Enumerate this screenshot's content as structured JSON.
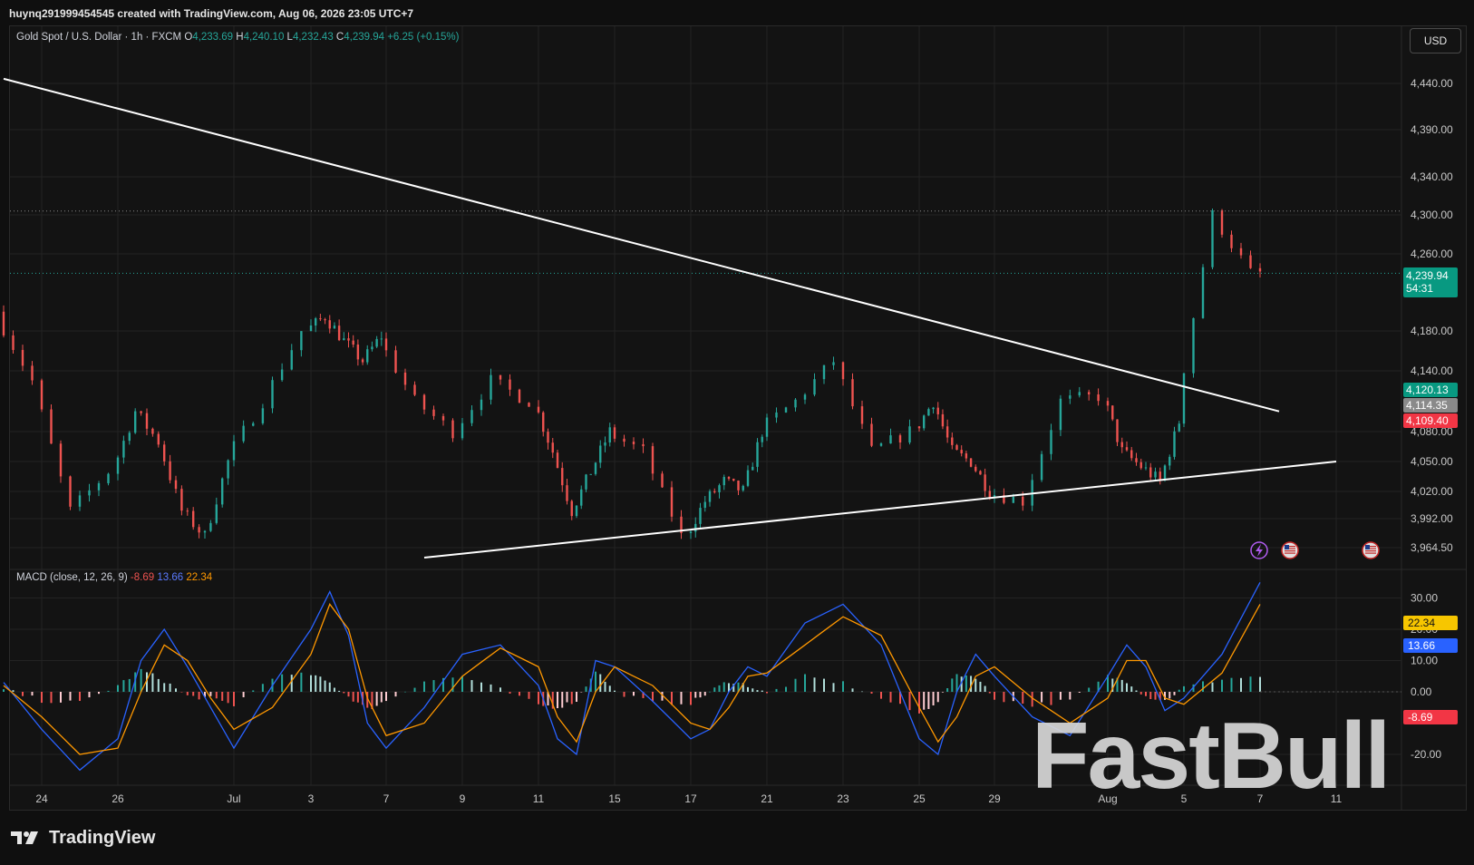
{
  "header": {
    "credit": "huynq291999454545 created with TradingView.com, Aug 06, 2026 23:05 UTC+7"
  },
  "legend": {
    "symbol": "Gold Spot / U.S. Dollar · 1h · FXCM",
    "o_label": "O",
    "o_value": "4,233.69",
    "h_label": "H",
    "h_value": "4,240.10",
    "l_label": "L",
    "l_value": "4,232.43",
    "c_label": "C",
    "c_value": "4,239.94",
    "change": "+6.25 (+0.15%)"
  },
  "currency_button": "USD",
  "price_axis": {
    "ticks": [
      "4,440.00",
      "4,390.00",
      "4,340.00",
      "4,300.00",
      "4,260.00",
      "4,180.00",
      "4,140.00",
      "4,080.00",
      "4,050.00",
      "4,020.00",
      "3,992.00",
      "3,964.50"
    ],
    "last_price": "4,239.94",
    "countdown": "54:31",
    "level_1": "4,120.13",
    "level_2": "4,114.35",
    "level_3": "4,109.40"
  },
  "macd": {
    "label": "MACD (close, 12, 26, 9)",
    "histogram": "-8.69",
    "macd": "13.66",
    "signal": "22.34",
    "ticks": [
      "30.00",
      "20.00",
      "10.00",
      "0.00",
      "-20.00"
    ]
  },
  "time_axis": [
    "24",
    "26",
    "Jul",
    "3",
    "7",
    "9",
    "11",
    "15",
    "17",
    "21",
    "23",
    "25",
    "29",
    "Aug",
    "5",
    "7",
    "11"
  ],
  "footer": {
    "brand": "TradingView"
  },
  "watermark": "FastBull",
  "colors": {
    "up": "#26a69a",
    "down": "#ef5350",
    "macd_line": "#2962ff",
    "signal_line": "#ff9800",
    "level_red": "#f23645",
    "level_green": "#089981"
  },
  "chart_data": [
    {
      "type": "candlestick",
      "title": "Gold Spot / U.S. Dollar · 1h · FXCM",
      "xlabel": "",
      "ylabel": "",
      "x_ticks": [
        "24",
        "26",
        "Jul",
        "3",
        "7",
        "9",
        "11",
        "15",
        "17",
        "21",
        "23",
        "25",
        "29",
        "Aug",
        "5",
        "7",
        "11"
      ],
      "ylim": [
        3950,
        4470
      ],
      "price_path": [
        {
          "x": "Jun 23",
          "y": 4200
        },
        {
          "x": "Jun 24",
          "y": 4130
        },
        {
          "x": "Jun 25",
          "y": 4000
        },
        {
          "x": "Jun 26",
          "y": 4040
        },
        {
          "x": "Jun 27",
          "y": 4100
        },
        {
          "x": "Jun 28",
          "y": 4070
        },
        {
          "x": "Jun 29",
          "y": 4000
        },
        {
          "x": "Jun 30",
          "y": 3975
        },
        {
          "x": "Jul 1",
          "y": 4050
        },
        {
          "x": "Jul 2",
          "y": 4110
        },
        {
          "x": "Jul 3",
          "y": 4180
        },
        {
          "x": "Jul 4",
          "y": 4195
        },
        {
          "x": "Jul 5",
          "y": 4170
        },
        {
          "x": "Jul 6",
          "y": 4150
        },
        {
          "x": "Jul 7",
          "y": 4175
        },
        {
          "x": "Jul 8",
          "y": 4110
        },
        {
          "x": "Jul 9",
          "y": 4080
        },
        {
          "x": "Jul 10",
          "y": 4130
        },
        {
          "x": "Jul 11",
          "y": 4110
        },
        {
          "x": "Jul 12",
          "y": 4060
        },
        {
          "x": "Jul 13",
          "y": 4000
        },
        {
          "x": "Jul 14",
          "y": 4040
        },
        {
          "x": "Jul 15",
          "y": 4080
        },
        {
          "x": "Jul 16",
          "y": 4060
        },
        {
          "x": "Jul 17",
          "y": 3975
        },
        {
          "x": "Jul 18",
          "y": 4010
        },
        {
          "x": "Jul 19",
          "y": 4030
        },
        {
          "x": "Jul 20",
          "y": 4020
        },
        {
          "x": "Jul 21",
          "y": 4080
        },
        {
          "x": "Jul 22",
          "y": 4110
        },
        {
          "x": "Jul 23",
          "y": 4150
        },
        {
          "x": "Jul 24",
          "y": 4060
        },
        {
          "x": "Jul 25",
          "y": 4080
        },
        {
          "x": "Jul 26",
          "y": 4110
        },
        {
          "x": "Jul 27",
          "y": 4060
        },
        {
          "x": "Jul 28",
          "y": 4050
        },
        {
          "x": "Jul 29",
          "y": 4020
        },
        {
          "x": "Jul 30",
          "y": 4010
        },
        {
          "x": "Jul 31",
          "y": 4110
        },
        {
          "x": "Aug 1",
          "y": 4115
        },
        {
          "x": "Aug 2",
          "y": 4060
        },
        {
          "x": "Aug 3",
          "y": 4045
        },
        {
          "x": "Aug 4",
          "y": 4030
        },
        {
          "x": "Aug 5",
          "y": 4090
        },
        {
          "x": "Aug 6",
          "y": 4300
        },
        {
          "x": "Aug 7",
          "y": 4240
        }
      ],
      "trendlines": [
        {
          "name": "descending resistance",
          "from": {
            "x": "Jun 23",
            "y": 4445
          },
          "to": {
            "x": "Aug 8",
            "y": 4100
          }
        },
        {
          "name": "ascending support",
          "from": {
            "x": "Jul 8",
            "y": 3955
          },
          "to": {
            "x": "Aug 11",
            "y": 4050
          }
        }
      ],
      "last_price": 4239.94
    },
    {
      "type": "line",
      "title": "MACD (close, 12, 26, 9)",
      "ylim": [
        -28,
        35
      ],
      "series": [
        {
          "name": "MACD",
          "last": 13.66,
          "values": [
            3,
            -12,
            -25,
            -15,
            10,
            20,
            8,
            -5,
            -18,
            2,
            20,
            32,
            18,
            -10,
            -18,
            -5,
            12,
            15,
            2,
            -15,
            -20,
            10,
            8,
            -3,
            -15,
            -12,
            0,
            8,
            5,
            22,
            28,
            15,
            -15,
            -20,
            0,
            12,
            5,
            -8,
            -14,
            5,
            15,
            8,
            -6,
            -2,
            12,
            35,
            13.66
          ]
        },
        {
          "name": "Signal",
          "last": 22.34,
          "values": [
            2,
            -8,
            -20,
            -18,
            0,
            15,
            10,
            -2,
            -12,
            -5,
            12,
            28,
            20,
            -2,
            -14,
            -10,
            5,
            14,
            8,
            -8,
            -16,
            0,
            8,
            2,
            -10,
            -12,
            -5,
            5,
            6,
            15,
            24,
            18,
            -5,
            -16,
            -8,
            5,
            8,
            -2,
            -10,
            -2,
            10,
            10,
            -2,
            -4,
            6,
            28,
            22.34
          ]
        },
        {
          "name": "Histogram",
          "last": -8.69
        }
      ]
    }
  ]
}
